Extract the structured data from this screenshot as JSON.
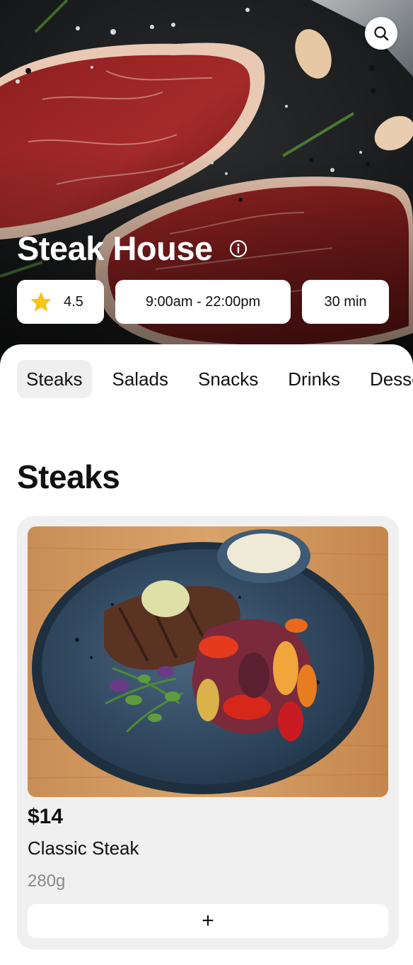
{
  "restaurant": {
    "name": "Steak House",
    "rating": "4.5",
    "hours": "9:00am - 22:00pm",
    "delivery_time": "30 min"
  },
  "icons": {
    "search": "search-icon",
    "info": "info-icon",
    "rating": "star-icon",
    "add": "plus-icon"
  },
  "colors": {
    "star": "#F5C518",
    "tab_active_bg": "#EFEFEF",
    "card_bg": "#F0F0F0",
    "muted_text": "#8A8A8A"
  },
  "tabs": [
    {
      "label": "Steaks",
      "active": true
    },
    {
      "label": "Salads",
      "active": false
    },
    {
      "label": "Snacks",
      "active": false
    },
    {
      "label": "Drinks",
      "active": false
    },
    {
      "label": "Desserts",
      "active": false
    }
  ],
  "section": {
    "title": "Steaks"
  },
  "products": [
    {
      "price": "$14",
      "name": "Classic Steak",
      "weight": "280g",
      "add_label": "+"
    }
  ]
}
